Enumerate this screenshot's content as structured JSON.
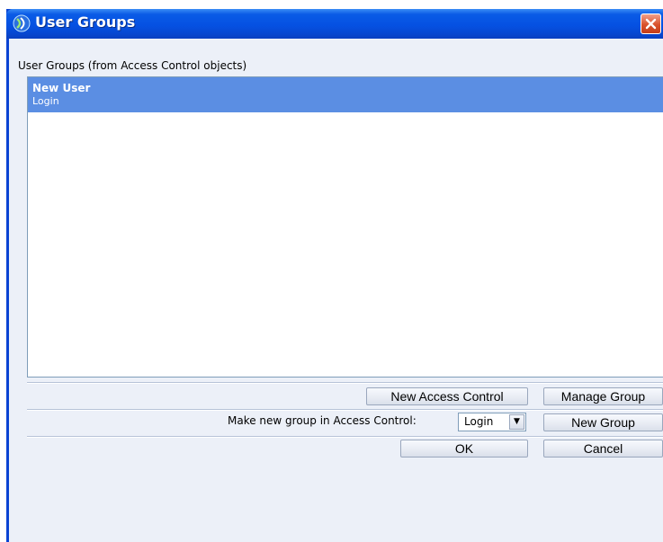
{
  "window": {
    "title": "User Groups"
  },
  "list": {
    "caption": "User Groups (from Access Control objects)",
    "items": [
      {
        "title": "New User",
        "subtitle": "Login"
      }
    ]
  },
  "buttons": {
    "new_access_control": "New Access Control",
    "manage_group": "Manage Group",
    "new_group": "New Group",
    "ok": "OK",
    "cancel": "Cancel"
  },
  "make_group": {
    "label": "Make new group in Access Control:",
    "selected": "Login"
  },
  "icons": {
    "app": "app-logo-icon",
    "close": "close-icon",
    "dropdown": "chevron-down-icon"
  },
  "colors": {
    "titlebar": "#0551e2",
    "selection": "#5b8ee3",
    "client_bg": "#ecf0f8",
    "close_button": "#d9522c"
  }
}
